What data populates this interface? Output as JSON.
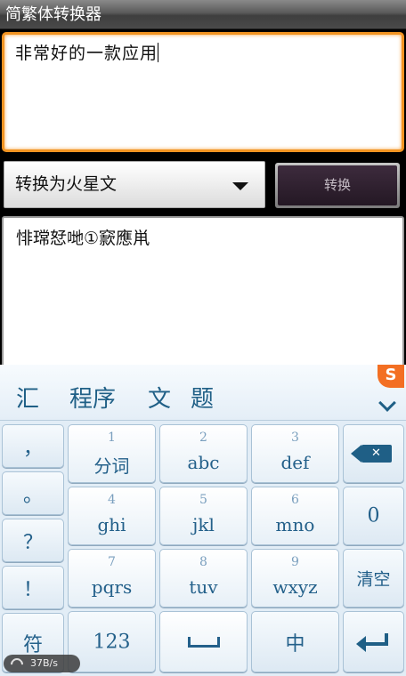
{
  "app": {
    "title": "简繁体转换器"
  },
  "input": {
    "text": "非常好的一款应用"
  },
  "selector": {
    "value": "转换为火星文"
  },
  "convert_button": {
    "label": "转换"
  },
  "output": {
    "text": "悱瑺恏哋①窾應鼡"
  },
  "ime": {
    "candidates": [
      "汇",
      "程序",
      "文",
      "题"
    ],
    "sogou_logo": "S",
    "left_column": [
      "，",
      "。",
      "？",
      "！",
      "符"
    ],
    "keys": [
      {
        "num": "1",
        "label": "分词"
      },
      {
        "num": "2",
        "label": "abc"
      },
      {
        "num": "3",
        "label": "def"
      },
      {
        "num": "4",
        "label": "ghi"
      },
      {
        "num": "5",
        "label": "jkl"
      },
      {
        "num": "6",
        "label": "mno"
      },
      {
        "num": "7",
        "label": "pqrs"
      },
      {
        "num": "8",
        "label": "tuv"
      },
      {
        "num": "9",
        "label": "wxyz"
      }
    ],
    "zero_key": "0",
    "clear_key": "清空",
    "num_mode_key": "123",
    "lang_key": "中"
  },
  "status": {
    "network_speed": "37B/s"
  }
}
